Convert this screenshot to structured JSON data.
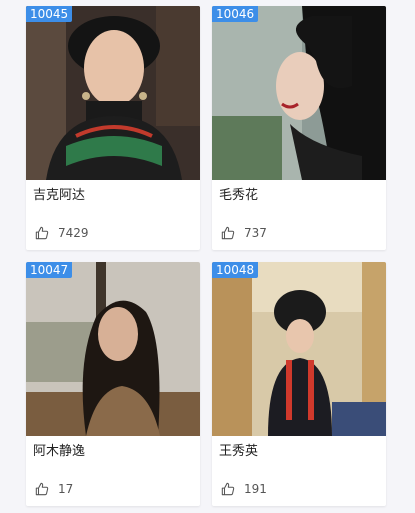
{
  "cards": [
    {
      "id": "10045",
      "name": "吉克阿达",
      "likes": "7429",
      "photo": "portrait-smiling-woman-in-yi-costume",
      "badge_color": "#3d8ee8"
    },
    {
      "id": "10046",
      "name": "毛秀花",
      "likes": "737",
      "photo": "portrait-woman-profile-long-hair",
      "badge_color": "#3d8ee8"
    },
    {
      "id": "10047",
      "name": "阿木静逸",
      "likes": "17",
      "photo": "portrait-woman-by-window",
      "badge_color": "#3d8ee8"
    },
    {
      "id": "10048",
      "name": "王秀英",
      "likes": "191",
      "photo": "portrait-woman-in-traditional-headdress",
      "badge_color": "#3d8ee8"
    }
  ],
  "icons": {
    "like": "thumbs-up-icon"
  }
}
